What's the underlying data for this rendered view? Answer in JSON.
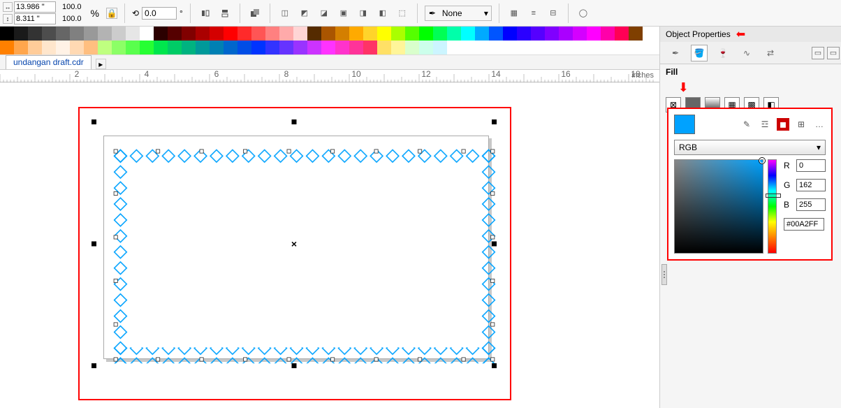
{
  "toolbar": {
    "width": "13.986 \"",
    "height": "8.311 \"",
    "scale_x": "100.0",
    "scale_y": "100.0",
    "angle": "0.0",
    "outline_val": "None"
  },
  "tab": {
    "name": "undangan draft.cdr"
  },
  "ruler": {
    "units": "inches",
    "marks": [
      2,
      4,
      6,
      8,
      10,
      12,
      14,
      16,
      18
    ]
  },
  "docker": {
    "title": "Object Properties",
    "section": "Fill",
    "model": "RGB",
    "r_label": "R",
    "r": "0",
    "g_label": "G",
    "g": "162",
    "b_label": "B",
    "b": "255",
    "hex": "#00A2FF",
    "swatch_color": "#00A2FF"
  },
  "palette_top": [
    "#000000",
    "#1a1a1a",
    "#333333",
    "#4d4d4d",
    "#666666",
    "#808080",
    "#999999",
    "#b3b3b3",
    "#cccccc",
    "#e6e6e6",
    "#ffffff",
    "#2b0000",
    "#550000",
    "#800000",
    "#aa0000",
    "#d40000",
    "#ff0000",
    "#ff2a2a",
    "#ff5555",
    "#ff8080",
    "#ffaaaa",
    "#ffd5d5",
    "#552b00",
    "#aa5500",
    "#d47f00",
    "#ffaa00",
    "#ffd42a",
    "#ffff00",
    "#aaff00",
    "#55ff00",
    "#00ff00",
    "#00ff55",
    "#00ffaa",
    "#00ffff",
    "#00aaff",
    "#0055ff",
    "#0000ff",
    "#2b00ff",
    "#5500ff",
    "#8000ff",
    "#aa00ff",
    "#d400ff",
    "#ff00ff",
    "#ff00aa",
    "#ff0055",
    "#7f3f00"
  ],
  "palette_bot": [
    "#ff8000",
    "#ffa64d",
    "#ffcc99",
    "#ffe6cc",
    "#fff2e6",
    "#ffd9b3",
    "#ffbf80",
    "#bfff80",
    "#8cff66",
    "#59ff4d",
    "#26ff33",
    "#00e64d",
    "#00cc66",
    "#00b380",
    "#009999",
    "#0080b3",
    "#0066cc",
    "#004de6",
    "#0033ff",
    "#3333ff",
    "#6633ff",
    "#9933ff",
    "#cc33ff",
    "#ff33ff",
    "#ff33cc",
    "#ff3399",
    "#ff3366",
    "#ffe066",
    "#fff599",
    "#d9ffcc",
    "#ccffeb",
    "#ccf5ff"
  ]
}
